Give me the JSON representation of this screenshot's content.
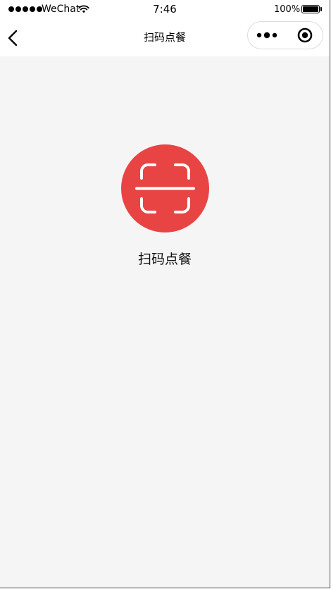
{
  "status_bar": {
    "carrier": "WeChat",
    "time": "7:46",
    "battery_percent": "100%",
    "battery_level": 1.0
  },
  "nav_bar": {
    "title": "扫码点餐",
    "back_icon": "chevron-left-icon",
    "more_icon": "more-dots-icon",
    "close_icon": "target-circle-icon"
  },
  "main": {
    "scan_icon": "scan-qr-icon",
    "scan_label": "扫码点餐",
    "accent_color": "#e84444"
  }
}
